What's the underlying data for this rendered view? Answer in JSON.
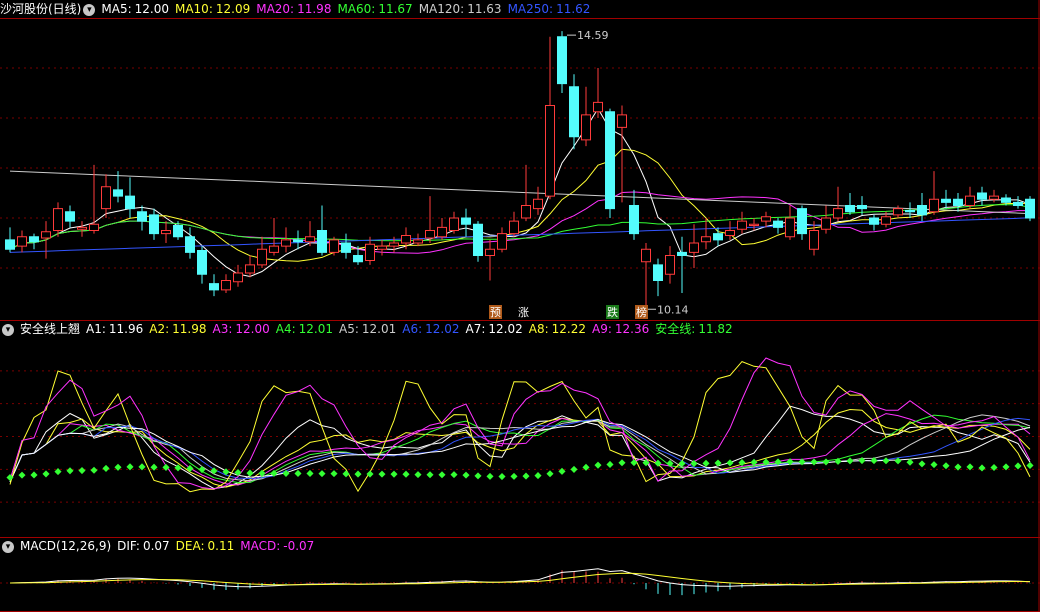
{
  "main_legend": {
    "title": "沙河股份(日线)",
    "items": [
      {
        "label": "MA5:",
        "value": "12.00",
        "color": "#ffffff"
      },
      {
        "label": "MA10:",
        "value": "12.09",
        "color": "#ffff33"
      },
      {
        "label": "MA20:",
        "value": "11.98",
        "color": "#ff33ff"
      },
      {
        "label": "MA60:",
        "value": "11.67",
        "color": "#33ff33"
      },
      {
        "label": "MA120:",
        "value": "11.63",
        "color": "#cccccc"
      },
      {
        "label": "MA250:",
        "value": "11.62",
        "color": "#3355ff"
      }
    ]
  },
  "safe_legend": {
    "title": "安全线上翘",
    "items": [
      {
        "label": "A1:",
        "value": "11.96",
        "color": "#ffffff"
      },
      {
        "label": "A2:",
        "value": "11.98",
        "color": "#ffff33"
      },
      {
        "label": "A3:",
        "value": "12.00",
        "color": "#ff33ff"
      },
      {
        "label": "A4:",
        "value": "12.01",
        "color": "#33ff33"
      },
      {
        "label": "A5:",
        "value": "12.01",
        "color": "#cccccc"
      },
      {
        "label": "A6:",
        "value": "12.02",
        "color": "#3355ff"
      },
      {
        "label": "A7:",
        "value": "12.02",
        "color": "#ffffff"
      },
      {
        "label": "A8:",
        "value": "12.22",
        "color": "#ffff33"
      },
      {
        "label": "A9:",
        "value": "12.36",
        "color": "#ff33ff"
      },
      {
        "label": "安全线:",
        "value": "11.82",
        "color": "#33ff33"
      }
    ]
  },
  "macd_legend": {
    "title": "MACD(12,26,9)",
    "items": [
      {
        "label": "DIF:",
        "value": "0.07",
        "color": "#ffffff"
      },
      {
        "label": "DEA:",
        "value": "0.11",
        "color": "#ffff33"
      },
      {
        "label": "MACD:",
        "value": "-0.07",
        "color": "#ff33ff"
      }
    ]
  },
  "annotations": {
    "high": "14.59",
    "low": "10.14",
    "tags": [
      {
        "text": "预",
        "bg": "#b05a1a",
        "fg": "#ffffff"
      },
      {
        "text": "涨",
        "bg": "#000000",
        "fg": "#ffffff"
      },
      {
        "text": "跌",
        "bg": "#1a7a1a",
        "fg": "#ffffff"
      },
      {
        "text": "榜",
        "bg": "#b05a1a",
        "fg": "#ffffff"
      }
    ]
  },
  "colors": {
    "up": "#ff3b3b",
    "down": "#54fcfc",
    "grid": "#7a0000",
    "border": "#a00000",
    "safe_dot": "#33ff33"
  },
  "chart_data": [
    {
      "type": "candlestick",
      "ylim": [
        10.0,
        14.8
      ],
      "candles": [
        [
          11.25,
          11.1,
          11.45,
          11.05
        ],
        [
          11.15,
          11.3,
          11.4,
          11.05
        ],
        [
          11.3,
          11.22,
          11.35,
          11.1
        ],
        [
          11.28,
          11.38,
          11.55,
          10.95
        ],
        [
          11.4,
          11.75,
          11.85,
          11.3
        ],
        [
          11.7,
          11.55,
          11.8,
          11.45
        ],
        [
          11.42,
          11.45,
          11.55,
          11.3
        ],
        [
          11.4,
          11.5,
          12.45,
          11.35
        ],
        [
          11.75,
          12.1,
          12.3,
          11.6
        ],
        [
          12.05,
          11.95,
          12.35,
          11.85
        ],
        [
          11.95,
          11.75,
          12.25,
          11.6
        ],
        [
          11.7,
          11.55,
          11.8,
          11.4
        ],
        [
          11.65,
          11.35,
          11.75,
          11.25
        ],
        [
          11.35,
          11.4,
          11.55,
          11.2
        ],
        [
          11.48,
          11.3,
          11.55,
          11.25
        ],
        [
          11.3,
          11.05,
          11.45,
          10.95
        ],
        [
          11.08,
          10.7,
          11.15,
          10.55
        ],
        [
          10.55,
          10.45,
          10.7,
          10.35
        ],
        [
          10.45,
          10.6,
          10.7,
          10.4
        ],
        [
          10.58,
          10.72,
          10.85,
          10.5
        ],
        [
          10.72,
          10.85,
          11.0,
          10.65
        ],
        [
          10.85,
          11.1,
          11.3,
          10.8
        ],
        [
          11.05,
          11.15,
          11.6,
          11.0
        ],
        [
          11.15,
          11.25,
          11.45,
          11.05
        ],
        [
          11.25,
          11.22,
          11.4,
          11.1
        ],
        [
          11.22,
          11.3,
          11.55,
          11.15
        ],
        [
          11.4,
          11.05,
          11.8,
          11.0
        ],
        [
          11.05,
          11.25,
          11.3,
          11.0
        ],
        [
          11.2,
          11.05,
          11.35,
          10.95
        ],
        [
          11.0,
          10.9,
          11.15,
          10.85
        ],
        [
          10.92,
          11.18,
          11.3,
          10.85
        ],
        [
          11.1,
          11.15,
          11.25,
          11.0
        ],
        [
          11.15,
          11.2,
          11.3,
          11.05
        ],
        [
          11.2,
          11.32,
          11.45,
          11.1
        ],
        [
          11.2,
          11.25,
          11.35,
          11.15
        ],
        [
          11.28,
          11.4,
          11.95,
          11.2
        ],
        [
          11.3,
          11.45,
          11.6,
          11.25
        ],
        [
          11.4,
          11.6,
          11.7,
          11.35
        ],
        [
          11.6,
          11.5,
          11.75,
          11.3
        ],
        [
          11.5,
          11.0,
          11.55,
          10.9
        ],
        [
          11.0,
          11.1,
          11.25,
          10.6
        ],
        [
          11.1,
          11.35,
          11.45,
          11.05
        ],
        [
          11.35,
          11.55,
          11.7,
          11.3
        ],
        [
          11.6,
          11.8,
          12.45,
          11.55
        ],
        [
          11.75,
          11.9,
          12.1,
          11.65
        ],
        [
          11.95,
          13.4,
          14.5,
          11.9
        ],
        [
          14.5,
          13.75,
          14.59,
          13.6
        ],
        [
          13.7,
          12.9,
          13.9,
          12.7
        ],
        [
          12.85,
          13.25,
          13.7,
          12.75
        ],
        [
          13.3,
          13.45,
          14.0,
          13.2
        ],
        [
          13.3,
          11.75,
          13.35,
          11.6
        ],
        [
          13.05,
          13.25,
          13.4,
          11.85
        ],
        [
          11.8,
          11.35,
          12.05,
          11.25
        ],
        [
          10.9,
          11.1,
          11.2,
          10.14
        ],
        [
          10.85,
          10.6,
          10.95,
          10.35
        ],
        [
          10.7,
          11.0,
          11.15,
          10.55
        ],
        [
          11.05,
          11.0,
          11.3,
          10.4
        ],
        [
          11.05,
          11.2,
          11.5,
          10.8
        ],
        [
          11.22,
          11.3,
          11.6,
          11.1
        ],
        [
          11.35,
          11.25,
          11.45,
          11.15
        ],
        [
          11.32,
          11.4,
          11.55,
          11.25
        ],
        [
          11.42,
          11.55,
          11.7,
          11.35
        ],
        [
          11.48,
          11.5,
          11.6,
          11.4
        ],
        [
          11.55,
          11.62,
          11.7,
          11.45
        ],
        [
          11.55,
          11.45,
          11.6,
          11.35
        ],
        [
          11.3,
          11.6,
          11.8,
          11.25
        ],
        [
          11.75,
          11.35,
          11.8,
          11.25
        ],
        [
          11.1,
          11.4,
          11.55,
          11.0
        ],
        [
          11.42,
          11.6,
          11.8,
          11.35
        ],
        [
          11.6,
          11.75,
          12.1,
          11.55
        ],
        [
          11.8,
          11.7,
          12.0,
          11.65
        ],
        [
          11.8,
          11.75,
          11.95,
          11.65
        ],
        [
          11.6,
          11.5,
          11.65,
          11.4
        ],
        [
          11.5,
          11.62,
          11.7,
          11.45
        ],
        [
          11.65,
          11.75,
          11.8,
          11.6
        ],
        [
          11.72,
          11.7,
          11.85,
          11.6
        ],
        [
          11.8,
          11.65,
          12.0,
          11.55
        ],
        [
          11.7,
          11.9,
          12.35,
          11.65
        ],
        [
          11.9,
          11.85,
          12.05,
          11.75
        ],
        [
          11.9,
          11.8,
          12.0,
          11.7
        ],
        [
          11.8,
          11.95,
          12.1,
          11.75
        ],
        [
          12.0,
          11.9,
          12.1,
          11.8
        ],
        [
          11.9,
          11.95,
          12.05,
          11.85
        ],
        [
          11.92,
          11.85,
          11.98,
          11.8
        ],
        [
          11.85,
          11.8,
          11.95,
          11.75
        ],
        [
          11.9,
          11.6,
          11.95,
          11.55
        ]
      ]
    },
    {
      "type": "line",
      "ylim": [
        0,
        100
      ]
    },
    {
      "type": "bar",
      "ylim": [
        -1,
        1
      ]
    }
  ]
}
